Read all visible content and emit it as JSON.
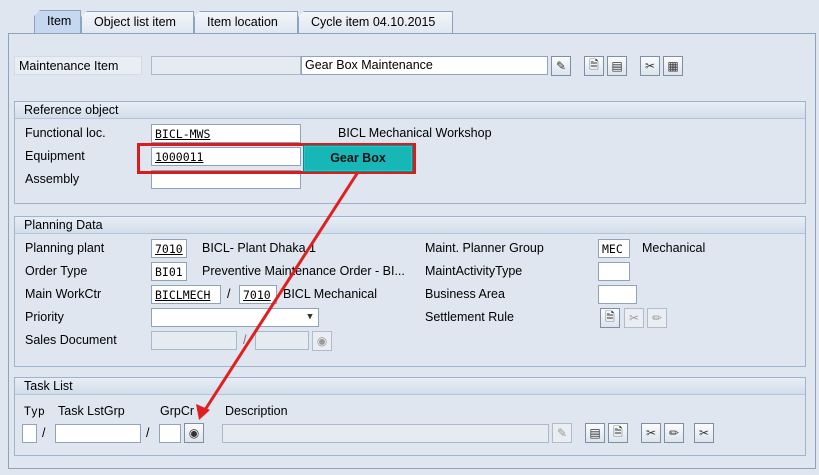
{
  "tabs": [
    {
      "label": "Item"
    },
    {
      "label": "Object list item"
    },
    {
      "label": "Item location"
    },
    {
      "label": "Cycle item 04.10.2015"
    }
  ],
  "header": {
    "maintenance_item_label": "Maintenance Item",
    "maintenance_item_value": "",
    "maintenance_item_text": "Gear Box Maintenance"
  },
  "reference_object": {
    "title": "Reference object",
    "functional_loc_label": "Functional loc.",
    "functional_loc_value": "BICL-MWS",
    "functional_loc_desc": "BICL Mechanical Workshop",
    "equipment_label": "Equipment",
    "equipment_value": "1000011",
    "assembly_label": "Assembly",
    "assembly_value": ""
  },
  "callout": {
    "text": "Gear Box",
    "color": "#18b7b7",
    "arrow_color": "#e02020"
  },
  "planning": {
    "title": "Planning Data",
    "planning_plant_label": "Planning plant",
    "planning_plant_value": "7010",
    "planning_plant_desc": "BICL- Plant Dhaka 1",
    "order_type_label": "Order Type",
    "order_type_value": "BI01",
    "order_type_desc": "Preventive Maintenance Order - BI...",
    "main_workctr_label": "Main WorkCtr",
    "main_workctr_value": "BICLMECH",
    "main_workctr_sep": "/",
    "main_workctr_plant": "7010",
    "main_workctr_desc": "BICL Mechanical",
    "priority_label": "Priority",
    "priority_value": "",
    "sales_document_label": "Sales Document",
    "sales_document_sep": "/",
    "planner_group_label": "Maint. Planner Group",
    "planner_group_value": "MEC",
    "planner_group_desc": "Mechanical",
    "activity_type_label": "MaintActivityType",
    "business_area_label": "Business Area",
    "settlement_rule_label": "Settlement Rule"
  },
  "task_list": {
    "title": "Task List",
    "typ_label": "Typ",
    "task_lstgrp_label": "Task LstGrp",
    "grpcr_label": "GrpCr",
    "description_label": "Description",
    "sep1": "/",
    "sep2": "/"
  },
  "icons": [
    "edit-long-text-icon",
    "document-icon",
    "display-icon",
    "scissors-icon",
    "stamp-icon",
    "binoculars-icon",
    "pencil-icon"
  ]
}
